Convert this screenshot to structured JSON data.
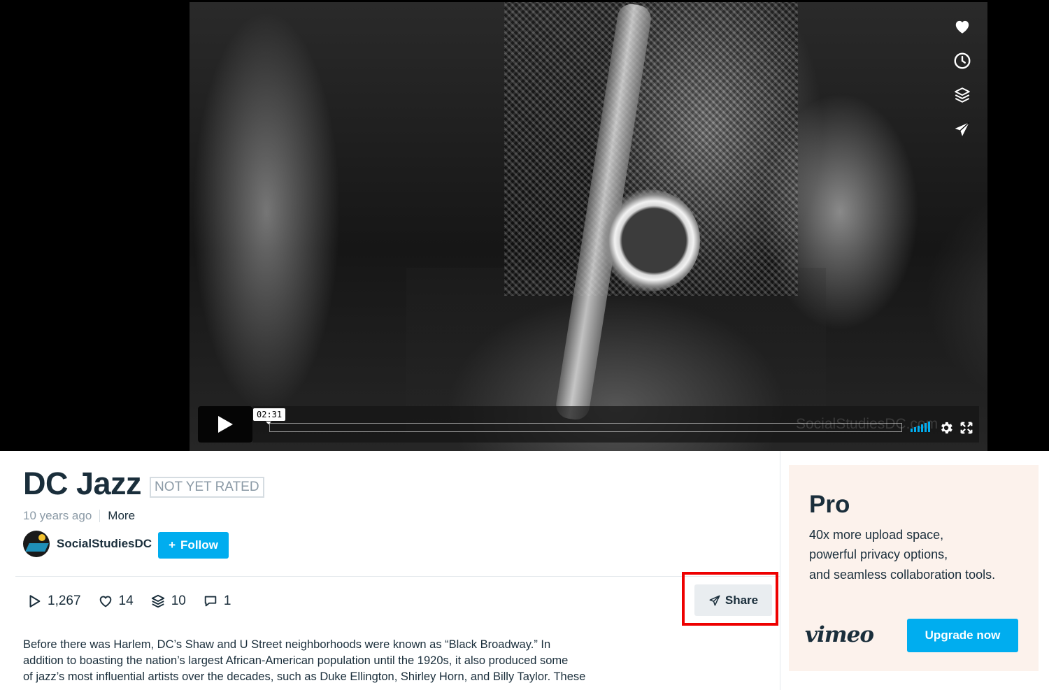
{
  "player": {
    "time_tooltip": "02:31",
    "watermark": "SocialStudiesDC.com",
    "side_actions": [
      "like-icon",
      "watch-later-icon",
      "collections-icon",
      "share-icon"
    ],
    "accent_color": "#00adef"
  },
  "video": {
    "title": "DC Jazz",
    "rating_badge": "NOT YET RATED",
    "posted": "10 years ago",
    "more_label": "More",
    "channel_name": "SocialStudiesDC",
    "follow_label": "Follow"
  },
  "stats": {
    "plays": "1,267",
    "likes": "14",
    "collections": "10",
    "comments": "1"
  },
  "share": {
    "label": "Share",
    "highlight_color": "#ee0000"
  },
  "description": {
    "line1": "Before there was Harlem, DC’s Shaw and U Street neighborhoods were known as “Black Broadway.” In",
    "line2": "addition to boasting the nation’s largest African-American population until the 1920s, it also produced some",
    "line3": "of jazz’s most influential artists over the decades, such as Duke Ellington, Shirley Horn, and Billy Taylor. These"
  },
  "pro_card": {
    "title": "Pro",
    "line1": "40x more upload space,",
    "line2": "powerful privacy options,",
    "line3": "and seamless collaboration tools.",
    "logo": "vimeo",
    "cta": "Upgrade now",
    "background": "#fcf2ec"
  }
}
